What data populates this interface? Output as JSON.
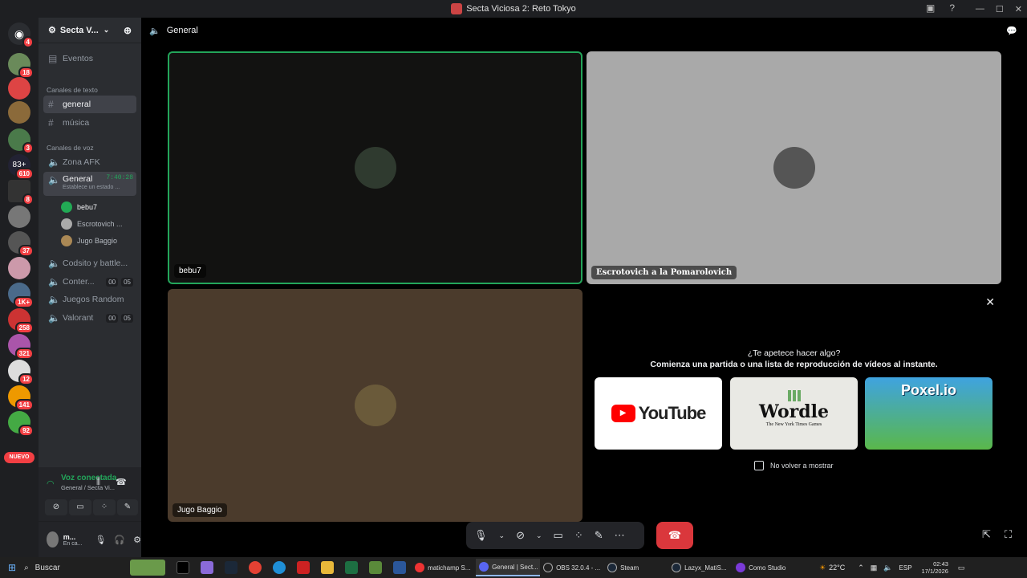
{
  "window": {
    "title": "Secta Viciosa 2: Reto Tokyo"
  },
  "server": {
    "name": "Secta V...",
    "events_label": "Eventos"
  },
  "text_category": "Canales de texto",
  "voice_category": "Canales de voz",
  "text_channels": [
    "general",
    "música"
  ],
  "voice_channels": {
    "afk": "Zona AFK",
    "general": {
      "name": "General",
      "timer": "7:40:28",
      "status": "Establece un estado ..."
    },
    "users": [
      "bebu7",
      "Escrotovich ...",
      "Jugo Baggio"
    ],
    "codsito": "Codsito y battle...",
    "conter": {
      "name": "Conter...",
      "a": "00",
      "b": "05"
    },
    "random": "Juegos Random",
    "valorant": {
      "name": "Valorant",
      "a": "00",
      "b": "05"
    }
  },
  "server_badges": [
    "4",
    "18",
    "3",
    "610",
    "8",
    "37",
    "1K+",
    "258",
    "321",
    "12",
    "141",
    "92"
  ],
  "new_badge": "NUEVO",
  "voice_panel": {
    "status": "Voz conectada",
    "location": "General / Secta Vi..."
  },
  "user_panel": {
    "name": "m...",
    "status": "En ca..."
  },
  "main": {
    "channel_title": "General"
  },
  "tiles": {
    "t1_name": "bebu7",
    "t2_name": "Escrotovich a la Pomarolovich",
    "t3_name": "Jugo Baggio"
  },
  "activity": {
    "question": "¿Te apetece hacer algo?",
    "subtitle": "Comienza una partida o una lista de reproducción de vídeos al instante.",
    "cards": [
      "YouTube",
      "Wordle",
      "Poxel.io"
    ],
    "wordle_sub": "The New York Times Games",
    "dont_show": "No volver a mostrar"
  },
  "taskbar": {
    "search": "Buscar",
    "apps": [
      "matichamp S...",
      "General | Sect...",
      "OBS 32.0.4 - ...",
      "Steam",
      "Lazyx_MatiS...",
      "Como Studio"
    ],
    "weather": "22°C",
    "lang": "ESP",
    "time": "02:43",
    "date": "17/1/2026"
  }
}
